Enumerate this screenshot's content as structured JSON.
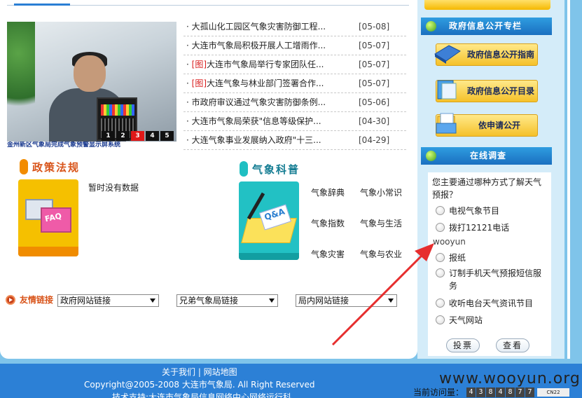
{
  "news": [
    {
      "tag": "",
      "title": "大孤山化工园区气象灾害防御工程...",
      "date": "[05-08]"
    },
    {
      "tag": "",
      "title": "大连市气象局积极开展人工增雨作...",
      "date": "[05-07]"
    },
    {
      "tag": "[图]",
      "title": "大连市气象局举行专家团队任...",
      "date": "[05-07]"
    },
    {
      "tag": "[图]",
      "title": "大连气象与林业部门签署合作...",
      "date": "[05-07]"
    },
    {
      "tag": "",
      "title": "市政府审议通过气象灾害防御条例...",
      "date": "[05-06]"
    },
    {
      "tag": "",
      "title": "大连市气象局荣获\"信息等级保护...",
      "date": "[04-30]"
    },
    {
      "tag": "",
      "title": "大连气象事业发展纳入政府\"十三...",
      "date": "[04-29]"
    }
  ],
  "slideshow": {
    "pages": [
      "1",
      "2",
      "3",
      "4",
      "5"
    ],
    "active_index": 2,
    "caption": "金州新区气象局完成气象预警显示屏系统"
  },
  "policy": {
    "title": "政策法规",
    "empty_text": "暂时没有数据"
  },
  "science": {
    "title": "气象科普",
    "links": [
      "气象辞典",
      "气象小常识",
      "气象指数",
      "气象与生活",
      "气象灾害",
      "气象与农业"
    ]
  },
  "friend_links": {
    "label": "友情链接",
    "selects": [
      "政府网站链接",
      "兄弟气象局链接",
      "局内网站链接"
    ]
  },
  "gov_info": {
    "title": "政府信息公开专栏",
    "buttons": [
      "政府信息公开指南",
      "政府信息公开目录",
      "依申请公开"
    ]
  },
  "survey": {
    "title": "在线调查",
    "question": "您主要通过哪种方式了解天气预报？",
    "options": [
      "电视气象节目",
      "拨打12121电话",
      "报纸",
      "订制手机天气预报短信服务",
      "收听电台天气资讯节目",
      "天气网站"
    ],
    "annotation": "wooyun",
    "vote_label": "投票",
    "view_label": "查看"
  },
  "footer": {
    "links": "关于我们 | 网站地图",
    "copyright": "Copyright@2005-2008 大连市气象局. All Right Reserved",
    "tech": "技术支持:大连市气象局信息网络中心网络运行科",
    "visits_label": "当前访问量：",
    "visits_digits": [
      "4",
      "3",
      "8",
      "4",
      "8",
      "7",
      "7"
    ],
    "badge": "CN22"
  },
  "watermark": "www.wooyun.org",
  "colors": {
    "accent": "#2c80d6",
    "policy": "#d8541a",
    "science": "#157d93",
    "arrow": "#e62e2e"
  }
}
